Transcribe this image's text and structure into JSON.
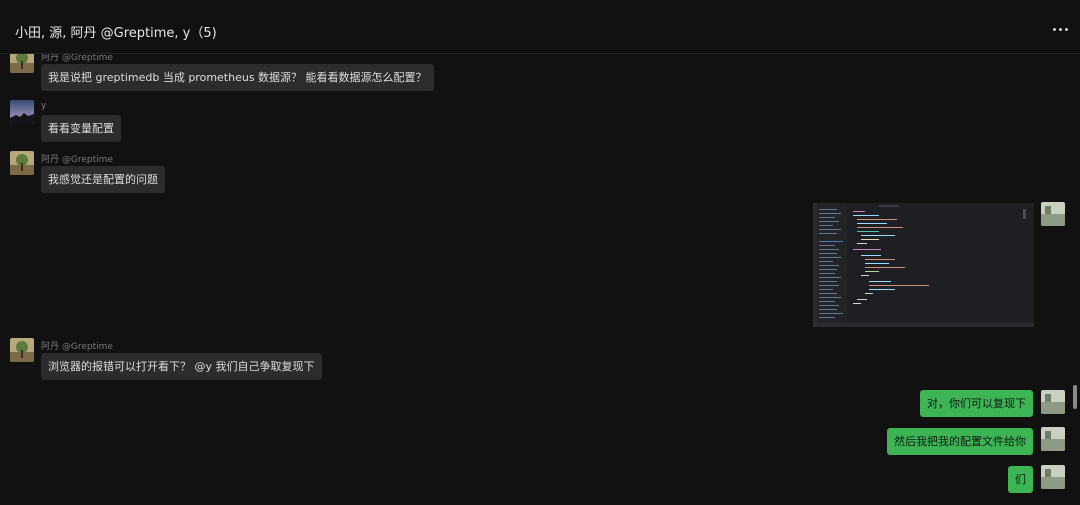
{
  "chat": {
    "title": "小田, 源, 阿丹 @Greptime, y（5)"
  },
  "messages": [
    {
      "sender": "阿丹 @Greptime",
      "text": "我是说把 greptimedb 当成 prometheus 数据源？ 能看看数据源怎么配置？"
    },
    {
      "sender": "y",
      "text": "看看变量配置"
    },
    {
      "sender": "阿丹 @Greptime",
      "text": "我感觉还是配置的问题"
    },
    {
      "sender": "me",
      "kind": "image",
      "image_desc": "code-editor-screenshot"
    },
    {
      "sender": "阿丹 @Greptime",
      "text": "浏览器的报错可以打开看下？ @y 我们自己争取复现下"
    },
    {
      "sender": "me",
      "text": "对，你们可以复现下"
    },
    {
      "sender": "me",
      "text": "然后我把我的配置文件给你"
    },
    {
      "sender": "me",
      "text": "们"
    }
  ],
  "colors": {
    "background": "#111111",
    "incoming_bubble": "#2c2c2c",
    "outgoing_bubble": "#3db555"
  }
}
